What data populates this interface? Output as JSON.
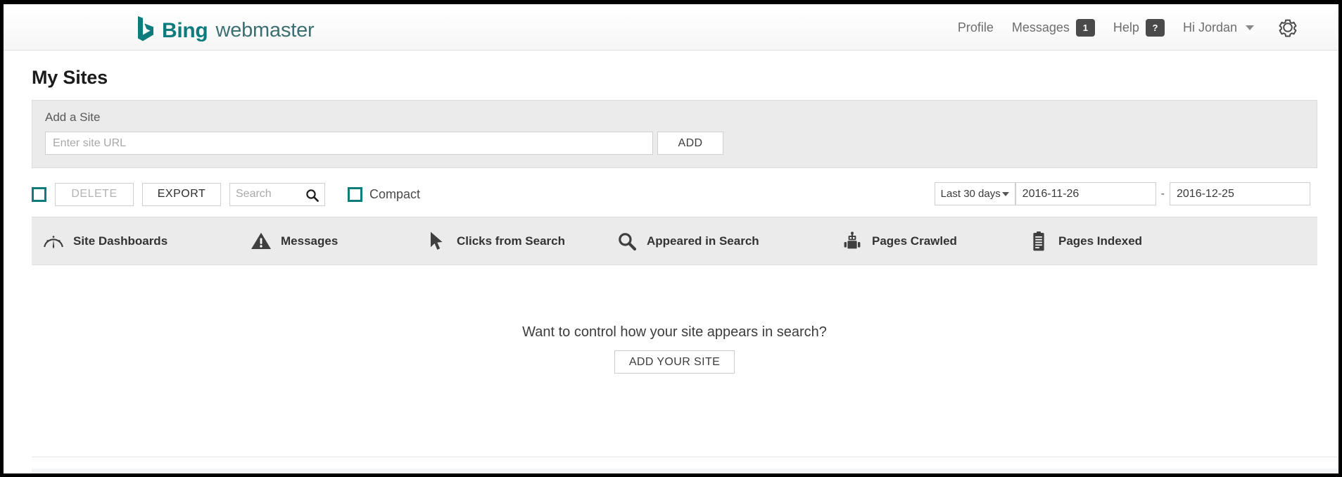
{
  "header": {
    "brand_primary": "Bing",
    "brand_secondary": "webmaster",
    "brand_color": "#0e7c7c",
    "nav": {
      "profile": "Profile",
      "messages": "Messages",
      "messages_badge": "1",
      "help": "Help",
      "help_badge": "?",
      "greeting": "Hi Jordan"
    },
    "settings_icon": "gear-icon"
  },
  "page": {
    "title": "My Sites"
  },
  "add_site": {
    "label": "Add a Site",
    "url_value": "",
    "url_placeholder": "Enter site URL",
    "add_button": "ADD"
  },
  "toolbar": {
    "select_all_checked": false,
    "delete_label": "DELETE",
    "delete_disabled": true,
    "export_label": "EXPORT",
    "search_value": "",
    "search_placeholder": "Search",
    "search_icon": "magnifier-icon",
    "compact_label": "Compact",
    "compact_checked": false,
    "accent_color": "#0e7c7c"
  },
  "date_range": {
    "preset": "Last 30 days",
    "start_date": "2016-11-26",
    "separator": "-",
    "end_date": "2016-12-25"
  },
  "columns": [
    {
      "label": "Site Dashboards",
      "icon": "gauge-icon"
    },
    {
      "label": "Messages",
      "icon": "warning-triangle-icon"
    },
    {
      "label": "Clicks from Search",
      "icon": "cursor-arrow-icon"
    },
    {
      "label": "Appeared in Search",
      "icon": "magnifier-icon"
    },
    {
      "label": "Pages Crawled",
      "icon": "robot-icon"
    },
    {
      "label": "Pages Indexed",
      "icon": "document-list-icon"
    }
  ],
  "empty_state": {
    "message": "Want to control how your site appears in search?",
    "cta_label": "ADD YOUR SITE"
  }
}
